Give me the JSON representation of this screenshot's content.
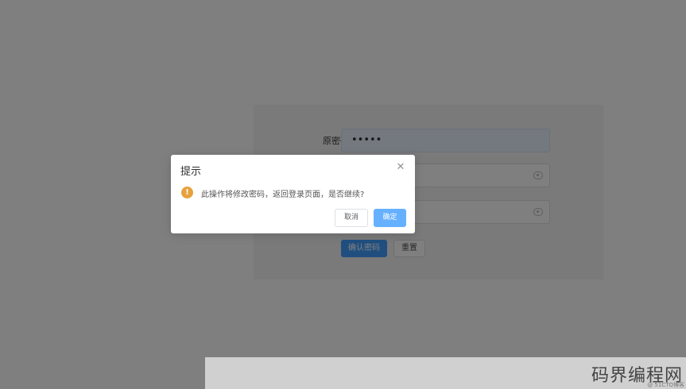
{
  "form": {
    "old_password_label": "原密码",
    "old_password_value": "•••••",
    "confirm_button": "确认密码",
    "reset_button": "重置"
  },
  "dialog": {
    "title": "提示",
    "close_glyph": "✕",
    "warning_glyph": "!",
    "message": "此操作将修改密码，返回登录页面，是否继续?",
    "cancel_label": "取消",
    "confirm_label": "确定"
  },
  "watermark": {
    "brand": "码界编程网",
    "sub": "@ 51CTO博客"
  },
  "colors": {
    "primary": "#409eff",
    "warning": "#e6a23c"
  }
}
